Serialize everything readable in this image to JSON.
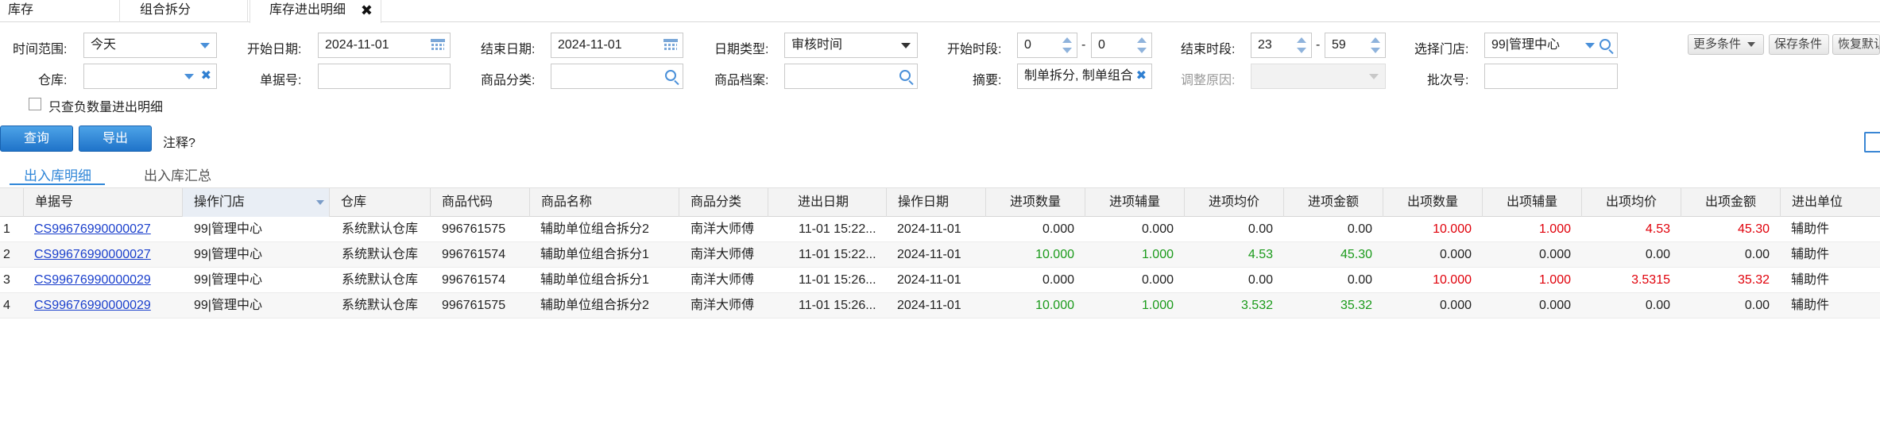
{
  "tabs": [
    {
      "label": "库存"
    },
    {
      "label": "组合拆分"
    },
    {
      "label": "库存进出明细",
      "active": true
    }
  ],
  "filters": {
    "time_range": {
      "label": "时间范围:",
      "value": "今天"
    },
    "start_date": {
      "label": "开始日期:",
      "value": "2024-11-01"
    },
    "end_date": {
      "label": "结束日期:",
      "value": "2024-11-01"
    },
    "date_type": {
      "label": "日期类型:",
      "value": "审核时间"
    },
    "start_period": {
      "label": "开始时段:",
      "hour": "0",
      "minute": "0",
      "separator": "-"
    },
    "end_period": {
      "label": "结束时段:",
      "hour": "23",
      "minute": "59",
      "separator": "-"
    },
    "store": {
      "label": "选择门店:",
      "value": "99|管理中心"
    },
    "warehouse": {
      "label": "仓库:",
      "value": ""
    },
    "doc_no": {
      "label": "单据号:",
      "value": ""
    },
    "category": {
      "label": "商品分类:",
      "value": ""
    },
    "product": {
      "label": "商品档案:",
      "value": ""
    },
    "summary": {
      "label": "摘要:",
      "value": "制单拆分, 制单组合"
    },
    "adjust_reason": {
      "label": "调整原因:",
      "value": ""
    },
    "batch_no": {
      "label": "批次号:",
      "value": ""
    },
    "negative_only": {
      "label": "只查负数量进出明细",
      "checked": false
    }
  },
  "actions": {
    "more": "更多条件",
    "save": "保存条件",
    "restore": "恢复默认",
    "query": "查询",
    "export": "导出",
    "note": "注释?"
  },
  "subtabs": [
    {
      "label": "出入库明细",
      "active": true
    },
    {
      "label": "出入库汇总"
    }
  ],
  "table": {
    "columns": [
      "",
      "单据号",
      "操作门店",
      "仓库",
      "商品代码",
      "商品名称",
      "商品分类",
      "进出日期",
      "操作日期",
      "进项数量",
      "进项辅量",
      "进项均价",
      "进项金额",
      "出项数量",
      "出项辅量",
      "出项均价",
      "出项金额",
      "进出单位"
    ],
    "rows": [
      {
        "idx": "1",
        "doc": "CS99676990000027",
        "store": "99|管理中心",
        "wh": "系统默认仓库",
        "code": "996761575",
        "name": "辅助单位组合拆分2",
        "cat": "南洋大师傅",
        "io_date": "11-01 15:22...",
        "op_date": "2024-11-01",
        "in_qty": "0.000",
        "in_aux": "0.000",
        "in_avg": "0.00",
        "in_amt": "0.00",
        "out_qty": "10.000",
        "out_aux": "1.000",
        "out_avg": "4.53",
        "out_amt": "45.30",
        "unit": "辅助件"
      },
      {
        "idx": "2",
        "doc": "CS99676990000027",
        "store": "99|管理中心",
        "wh": "系统默认仓库",
        "code": "996761574",
        "name": "辅助单位组合拆分1",
        "cat": "南洋大师傅",
        "io_date": "11-01 15:22...",
        "op_date": "2024-11-01",
        "in_qty": "10.000",
        "in_aux": "1.000",
        "in_avg": "4.53",
        "in_amt": "45.30",
        "out_qty": "0.000",
        "out_aux": "0.000",
        "out_avg": "0.00",
        "out_amt": "0.00",
        "unit": "辅助件"
      },
      {
        "idx": "3",
        "doc": "CS99676990000029",
        "store": "99|管理中心",
        "wh": "系统默认仓库",
        "code": "996761574",
        "name": "辅助单位组合拆分1",
        "cat": "南洋大师傅",
        "io_date": "11-01 15:26...",
        "op_date": "2024-11-01",
        "in_qty": "0.000",
        "in_aux": "0.000",
        "in_avg": "0.00",
        "in_amt": "0.00",
        "out_qty": "10.000",
        "out_aux": "1.000",
        "out_avg": "3.5315",
        "out_amt": "35.32",
        "unit": "辅助件"
      },
      {
        "idx": "4",
        "doc": "CS99676990000029",
        "store": "99|管理中心",
        "wh": "系统默认仓库",
        "code": "996761575",
        "name": "辅助单位组合拆分2",
        "cat": "南洋大师傅",
        "io_date": "11-01 15:26...",
        "op_date": "2024-11-01",
        "in_qty": "10.000",
        "in_aux": "1.000",
        "in_avg": "3.532",
        "in_amt": "35.32",
        "out_qty": "0.000",
        "out_aux": "0.000",
        "out_avg": "0.00",
        "out_amt": "0.00",
        "unit": "辅助件"
      }
    ]
  },
  "colors": {
    "accent": "#2f86d8",
    "in": "#1a9a1a",
    "out": "#e0000a",
    "link": "#1a3fcc"
  }
}
